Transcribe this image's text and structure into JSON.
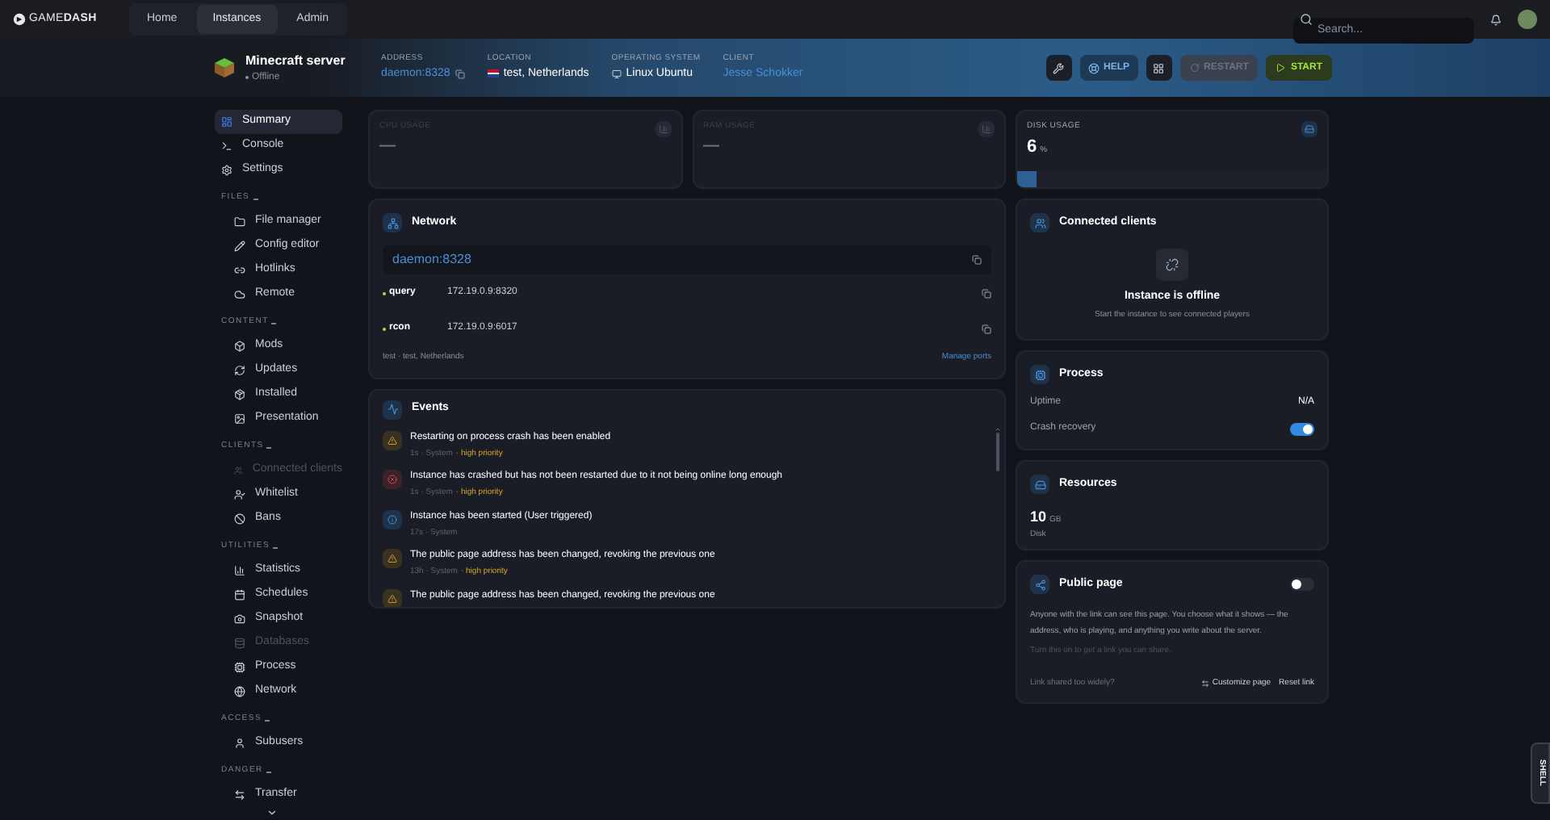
{
  "brand": {
    "name_light": "GAME",
    "name_bold": "DASH"
  },
  "nav_tabs": [
    {
      "label": "Home",
      "selected": false
    },
    {
      "label": "Instances",
      "selected": true
    },
    {
      "label": "Admin",
      "selected": false
    }
  ],
  "search": {
    "placeholder": "Search..."
  },
  "instance": {
    "name": "Minecraft server",
    "status": "Offline",
    "online": false,
    "info": [
      {
        "kind": "address",
        "label": "ADDRESS",
        "value": "daemon:8328"
      },
      {
        "kind": "location",
        "label": "LOCATION",
        "value": "test, Netherlands"
      },
      {
        "kind": "os",
        "label": "OPERATING SYSTEM",
        "value": "Linux Ubuntu"
      },
      {
        "kind": "client",
        "label": "CLIENT",
        "value": "Jesse Schokker"
      }
    ]
  },
  "actions": [
    {
      "kind": "tool"
    },
    {
      "kind": "help",
      "label": "HELP",
      "disabled": false
    },
    {
      "kind": "grid"
    },
    {
      "kind": "restart",
      "label": "RESTART",
      "disabled": true
    },
    {
      "kind": "start",
      "label": "START",
      "disabled": false
    }
  ],
  "sidebar": [
    {
      "kind": "item",
      "label": "Summary",
      "selected": true,
      "disabled": false
    },
    {
      "kind": "item",
      "label": "Console",
      "selected": false,
      "disabled": false
    },
    {
      "kind": "item",
      "label": "Settings",
      "selected": false,
      "disabled": false
    },
    {
      "kind": "section",
      "label": "FILES",
      "children": [
        {
          "label": "File manager",
          "selected": false,
          "disabled": false
        },
        {
          "label": "Config editor",
          "selected": false,
          "disabled": false
        },
        {
          "label": "Hotlinks",
          "selected": false,
          "disabled": false
        },
        {
          "label": "Remote",
          "selected": false,
          "disabled": false
        }
      ]
    },
    {
      "kind": "section",
      "label": "CONTENT",
      "children": [
        {
          "label": "Mods",
          "selected": false,
          "disabled": false
        },
        {
          "label": "Updates",
          "selected": false,
          "disabled": false
        },
        {
          "label": "Installed",
          "selected": false,
          "disabled": false
        },
        {
          "label": "Presentation",
          "selected": false,
          "disabled": false
        }
      ]
    },
    {
      "kind": "section",
      "label": "CLIENTS",
      "children": [
        {
          "label": "Connected clients",
          "selected": false,
          "disabled": true
        },
        {
          "label": "Whitelist",
          "selected": false,
          "disabled": false
        },
        {
          "label": "Bans",
          "selected": false,
          "disabled": false
        }
      ]
    },
    {
      "kind": "section",
      "label": "UTILITIES",
      "children": [
        {
          "label": "Statistics",
          "selected": false,
          "disabled": false
        },
        {
          "label": "Schedules",
          "selected": false,
          "disabled": false
        },
        {
          "label": "Snapshot",
          "selected": false,
          "disabled": false
        },
        {
          "label": "Databases",
          "selected": false,
          "disabled": true
        },
        {
          "label": "Process",
          "selected": false,
          "disabled": false
        },
        {
          "label": "Network",
          "selected": false,
          "disabled": false
        }
      ]
    },
    {
      "kind": "section",
      "label": "ACCESS",
      "children": [
        {
          "label": "Subusers",
          "selected": false,
          "disabled": false
        }
      ]
    },
    {
      "kind": "section",
      "label": "DANGER",
      "children": [
        {
          "label": "Transfer",
          "selected": false,
          "disabled": false
        }
      ]
    }
  ],
  "stats": [
    {
      "label": "CPU USAGE",
      "value": "—",
      "disabled": true
    },
    {
      "label": "RAM USAGE",
      "value": "—",
      "disabled": true
    }
  ],
  "disk": {
    "label": "DISK USAGE",
    "value": "6",
    "unit": "%",
    "level": 0.06
  },
  "network": {
    "title": "Network",
    "address": "daemon:8328",
    "ports": [
      {
        "name": "query",
        "address": "172.19.0.9:8320",
        "color": "#c8d23c"
      },
      {
        "name": "rcon",
        "address": "172.19.0.9:6017",
        "color": "#c8d23c"
      }
    ],
    "footer": "test · test, Netherlands",
    "manage": "Manage ports"
  },
  "events": {
    "title": "Events",
    "separator": "·",
    "items": [
      {
        "kind": "warning",
        "title": "Restarting on process crash has been enabled",
        "meta": "1s · System",
        "priority": "high priority"
      },
      {
        "kind": "error",
        "title": "Instance has crashed but has not been restarted due to it not being online long enough",
        "meta": "1s · System",
        "priority": "high priority"
      },
      {
        "kind": "info",
        "title": "Instance has been started (User triggered)",
        "meta": "17s · System"
      },
      {
        "kind": "warning",
        "title": "The public page address has been changed, revoking the previous one",
        "meta": "13h · System",
        "priority": "high priority"
      },
      {
        "kind": "warning",
        "title": "The public page address has been changed, revoking the previous one"
      }
    ]
  },
  "clients": {
    "title": "Connected clients",
    "message": "Instance is offline",
    "hint": "Start the instance to see connected players"
  },
  "process": {
    "title": "Process",
    "rows": [
      {
        "kind": "text",
        "label": "Uptime",
        "value": "N/A"
      },
      {
        "kind": "toggle",
        "label": "Crash recovery",
        "on": true
      }
    ]
  },
  "resources": {
    "title": "Resources",
    "value": "10",
    "unit": "GB",
    "label": "Disk"
  },
  "public_page": {
    "title": "Public page",
    "on": false,
    "description": "Anyone with the link can see this page. You choose what it shows — the address, who is playing, and anything you write about the server.",
    "hint": "Turn this on to get a link you can share.",
    "question": "Link shared too widely?",
    "customize": "Customize page",
    "reset": "Reset link"
  },
  "shell": {
    "label": "SHELL"
  }
}
